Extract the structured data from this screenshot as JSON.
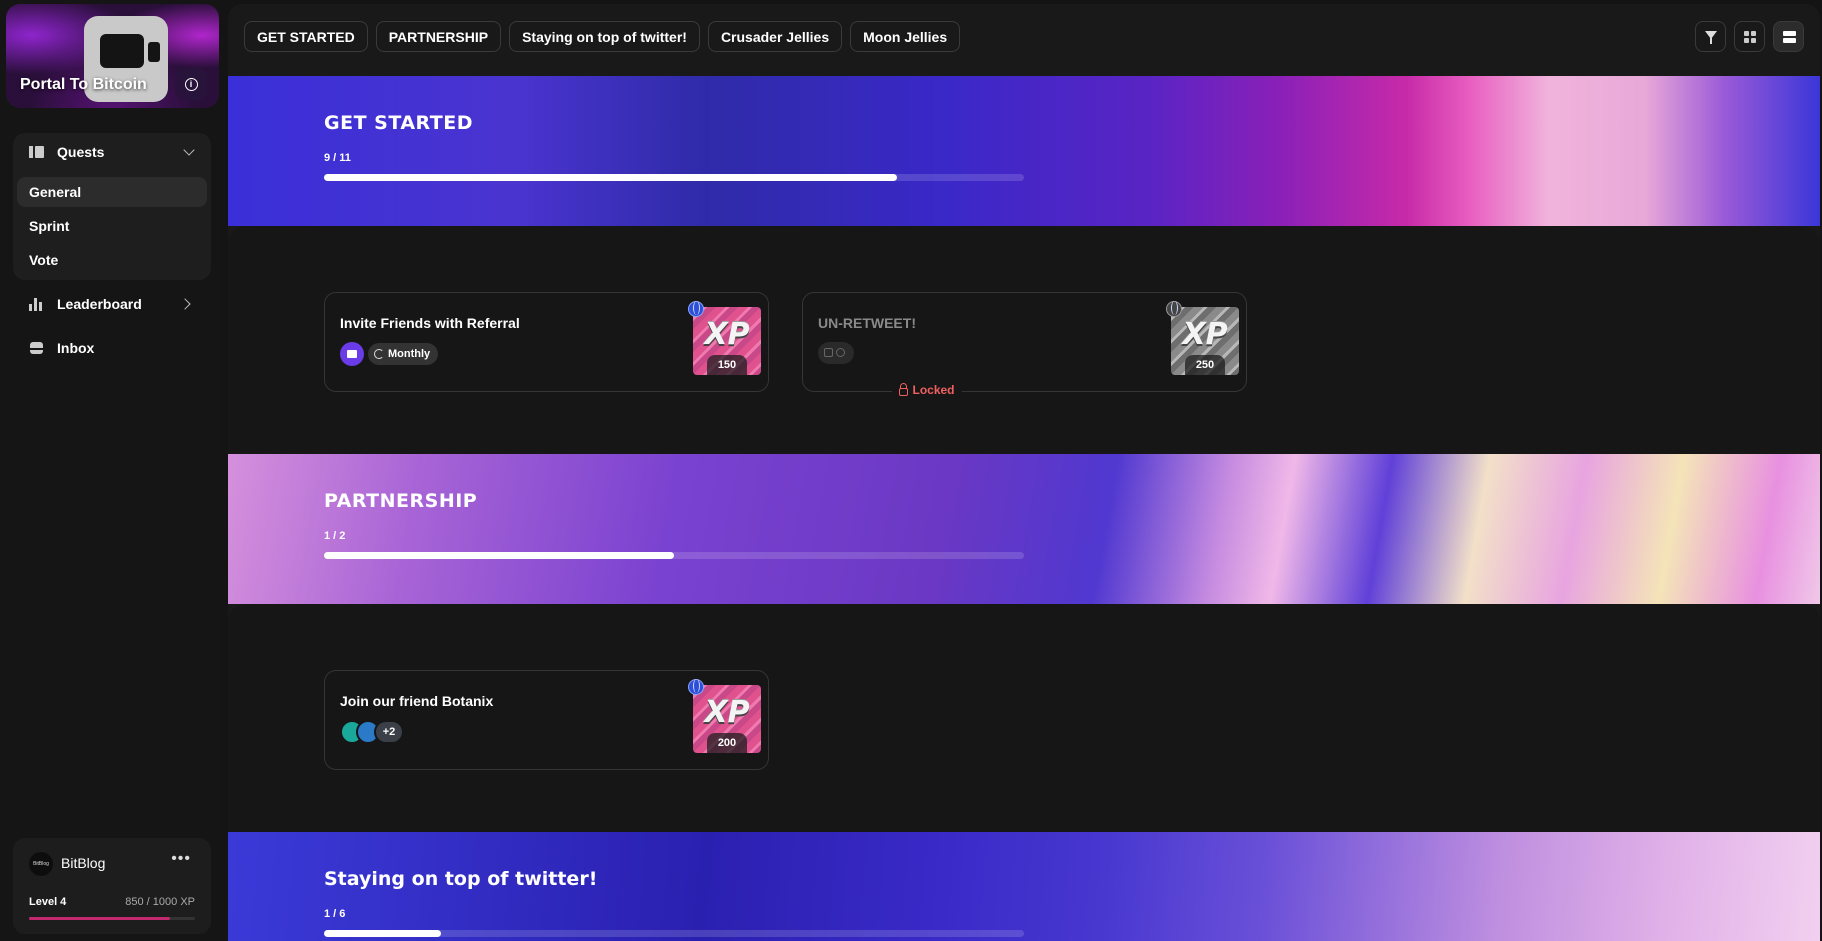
{
  "sidebar": {
    "community_name": "Portal To Bitcoin",
    "quests_label": "Quests",
    "sub_items": [
      "General",
      "Sprint",
      "Vote"
    ],
    "leaderboard_label": "Leaderboard",
    "inbox_label": "Inbox",
    "user": {
      "avatar_text": "BitBlog",
      "name": "BitBlog",
      "menu": "•••",
      "level": "Level 4",
      "xp": "850 / 1000 XP",
      "progress": 0.85
    }
  },
  "tabs": [
    "GET STARTED",
    "PARTNERSHIP",
    "Staying on top of twitter!",
    "Crusader Jellies",
    "Moon Jellies"
  ],
  "sections": [
    {
      "title": "GET STARTED",
      "count": "9 / 11",
      "progress": 0.818,
      "quests": [
        {
          "title": "Invite Friends with Referral",
          "badge": "Monthly",
          "xp_word": "XP",
          "xp": "150",
          "locked": false
        },
        {
          "title": "UN-RETWEET!",
          "xp_word": "XP",
          "xp": "250",
          "locked": true,
          "locked_label": "Locked"
        }
      ]
    },
    {
      "title": "PARTNERSHIP",
      "count": "1 / 2",
      "progress": 0.5,
      "quests": [
        {
          "title": "Join our friend Botanix",
          "extra_count": "+2",
          "xp_word": "XP",
          "xp": "200",
          "locked": false
        }
      ]
    },
    {
      "title": "Staying on top of twitter!",
      "count": "1 / 6",
      "progress": 0.167
    }
  ],
  "colors": {
    "level_bar": "#c2296e",
    "locked": "#f06060",
    "mail_chip": "#6a3ce8"
  }
}
